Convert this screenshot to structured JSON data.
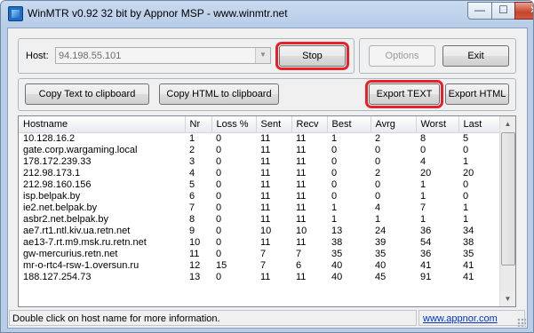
{
  "window": {
    "title": "WinMTR v0.92 32 bit by Appnor MSP - www.winmtr.net",
    "min_glyph": "—",
    "max_glyph": "☐",
    "close_glyph": "✕"
  },
  "host": {
    "label": "Host:",
    "value": "94.198.55.101"
  },
  "buttons": {
    "stop": "Stop",
    "options": "Options",
    "exit": "Exit",
    "copy_text": "Copy Text to clipboard",
    "copy_html": "Copy HTML to clipboard",
    "export_text": "Export TEXT",
    "export_html": "Export HTML"
  },
  "table": {
    "columns": [
      "Hostname",
      "Nr",
      "Loss %",
      "Sent",
      "Recv",
      "Best",
      "Avrg",
      "Worst",
      "Last"
    ],
    "rows": [
      [
        "10.128.16.2",
        "1",
        "0",
        "11",
        "11",
        "1",
        "2",
        "8",
        "5"
      ],
      [
        "gate.corp.wargaming.local",
        "2",
        "0",
        "11",
        "11",
        "0",
        "0",
        "0",
        "0"
      ],
      [
        "178.172.239.33",
        "3",
        "0",
        "11",
        "11",
        "0",
        "0",
        "4",
        "1"
      ],
      [
        "212.98.173.1",
        "4",
        "0",
        "11",
        "11",
        "0",
        "2",
        "20",
        "20"
      ],
      [
        "212.98.160.156",
        "5",
        "0",
        "11",
        "11",
        "0",
        "0",
        "1",
        "0"
      ],
      [
        "isp.belpak.by",
        "6",
        "0",
        "11",
        "11",
        "0",
        "0",
        "1",
        "0"
      ],
      [
        "ie2.net.belpak.by",
        "7",
        "0",
        "11",
        "11",
        "1",
        "4",
        "7",
        "1"
      ],
      [
        "asbr2.net.belpak.by",
        "8",
        "0",
        "11",
        "11",
        "1",
        "1",
        "1",
        "1"
      ],
      [
        "ae7.rt1.ntl.kiv.ua.retn.net",
        "9",
        "0",
        "10",
        "10",
        "13",
        "24",
        "36",
        "34"
      ],
      [
        "ae13-7.rt.m9.msk.ru.retn.net",
        "10",
        "0",
        "11",
        "11",
        "38",
        "39",
        "54",
        "38"
      ],
      [
        "gw-mercurius.retn.net",
        "11",
        "0",
        "7",
        "7",
        "35",
        "35",
        "36",
        "35"
      ],
      [
        "mr-o-rtc4-rsw-1.oversun.ru",
        "12",
        "15",
        "7",
        "6",
        "40",
        "40",
        "41",
        "41"
      ],
      [
        "188.127.254.73",
        "13",
        "0",
        "11",
        "11",
        "40",
        "45",
        "91",
        "41"
      ]
    ]
  },
  "status": {
    "message": "Double click on host name for more information.",
    "link": "www.appnor.com"
  }
}
